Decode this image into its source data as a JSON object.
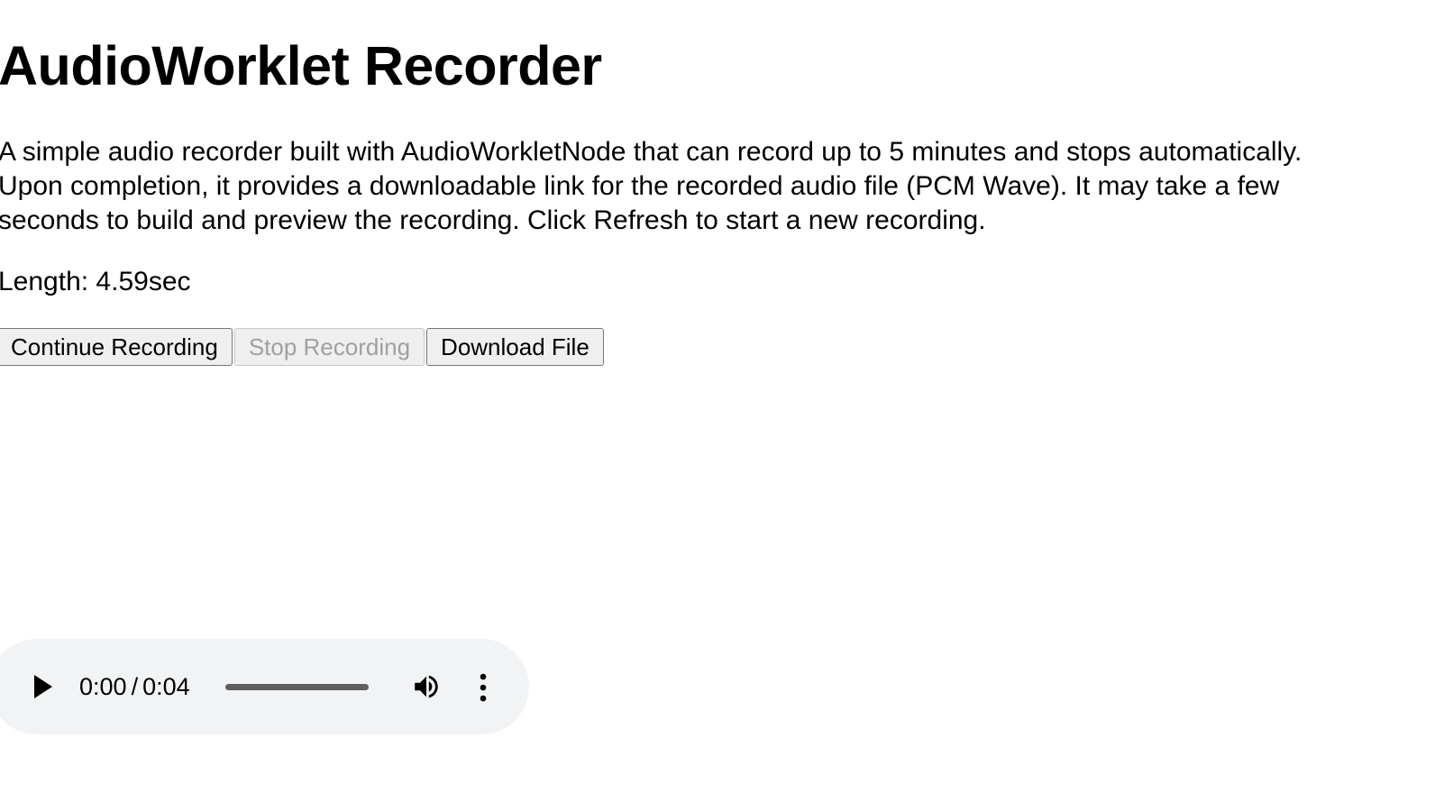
{
  "page": {
    "title": "AudioWorklet Recorder",
    "description_lines": [
      "A simple audio recorder built with AudioWorkletNode that can record up to 5 minutes and stops automatically.",
      "Upon completion, it provides a downloadable link for the recorded audio file (PCM Wave). It may take a few",
      "seconds to build and preview the recording. Click Refresh to start a new recording."
    ],
    "length_text": "Length: 4.59sec"
  },
  "buttons": {
    "continue_label": "Continue Recording",
    "stop_label": "Stop Recording",
    "stop_disabled": true,
    "download_label": "Download File"
  },
  "audio_player": {
    "current_time": "0:00",
    "separator": "/",
    "duration": "0:04",
    "progress": 0,
    "icons": {
      "play": "play-icon",
      "volume": "volume-icon",
      "menu": "more-vertical-icon"
    },
    "colors": {
      "background": "#f1f3f4",
      "track": "#5f5f5f"
    }
  }
}
